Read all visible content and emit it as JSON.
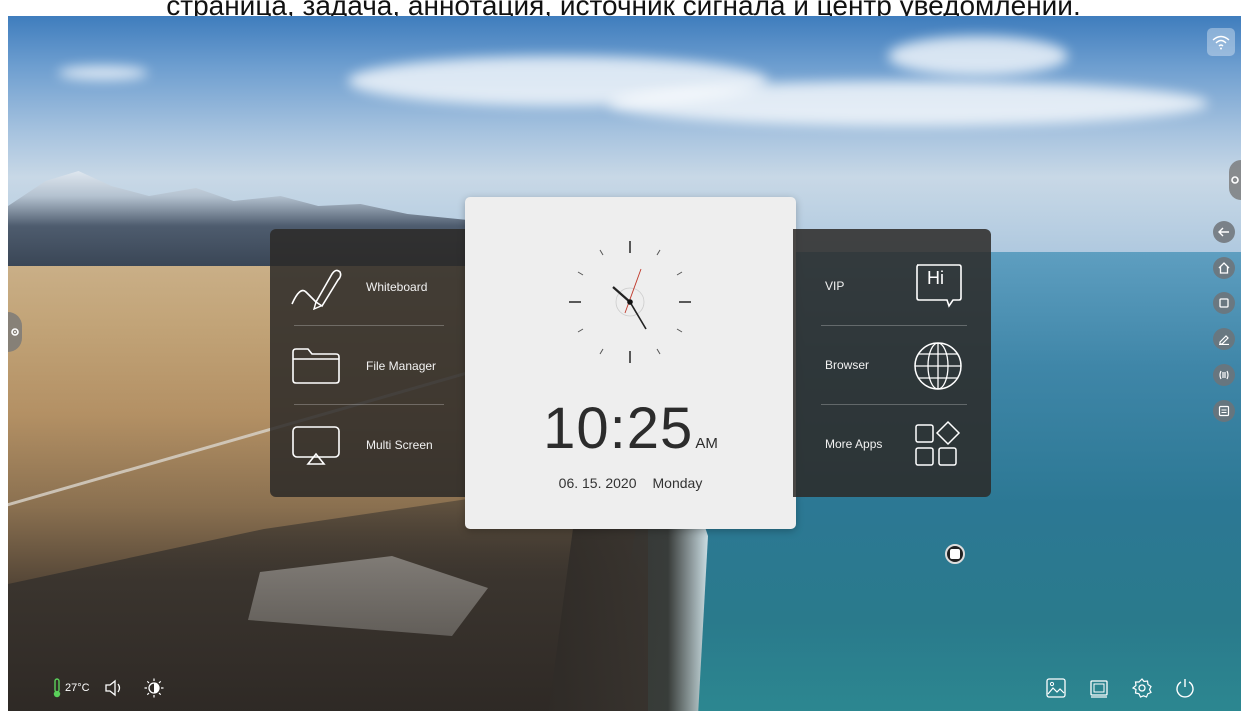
{
  "caption": "страница, задача, аннотация, источник сигнала и центр уведомлений.",
  "left_panel": {
    "items": [
      {
        "label": "Whiteboard",
        "icon": "whiteboard-icon"
      },
      {
        "label": "File Manager",
        "icon": "folder-icon"
      },
      {
        "label": "Multi Screen",
        "icon": "multi-screen-icon"
      }
    ]
  },
  "clock": {
    "time": "10:25",
    "ampm": "AM",
    "date": "06. 15. 2020",
    "weekday": "Monday"
  },
  "right_panel": {
    "items": [
      {
        "label": "VIP",
        "icon": "hi-chat-icon",
        "icon_text": "Hi"
      },
      {
        "label": "Browser",
        "icon": "globe-icon"
      },
      {
        "label": "More Apps",
        "icon": "apps-grid-icon"
      }
    ]
  },
  "sidebar": {
    "items": [
      "back-icon",
      "home-icon",
      "recent-tasks-icon",
      "annotation-icon",
      "signal-source-icon",
      "notification-center-icon"
    ]
  },
  "status_bar": {
    "temperature": "27°C",
    "left_icons": [
      "thermometer-icon",
      "volume-icon",
      "brightness-icon"
    ],
    "right_icons": [
      "gallery-icon",
      "screenshot-icon",
      "settings-icon",
      "power-icon"
    ]
  },
  "colors": {
    "panel_dark": "#2c2a28",
    "panel_light": "#eeeeee",
    "thermometer": "#5ad05a",
    "second_hand": "#c0392b"
  }
}
